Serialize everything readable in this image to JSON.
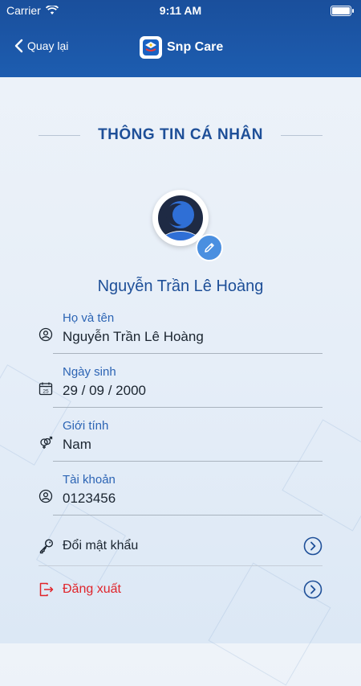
{
  "status": {
    "carrier": "Carrier",
    "time": "9:11 AM"
  },
  "nav": {
    "back_label": "Quay lại",
    "app_name": "Snp Care"
  },
  "section_title": "THÔNG TIN CÁ NHÂN",
  "profile": {
    "display_name": "Nguyễn Trần Lê Hoàng"
  },
  "fields": [
    {
      "label": "Họ và tên",
      "value": "Nguyễn Trần Lê Hoàng",
      "icon": "user-icon"
    },
    {
      "label": "Ngày sinh",
      "value": "29 / 09 / 2000",
      "icon": "calendar-icon",
      "calendar_day": "25"
    },
    {
      "label": "Giới tính",
      "value": "Nam",
      "icon": "gender-icon"
    },
    {
      "label": "Tài khoản",
      "value": "0123456",
      "icon": "user-icon"
    }
  ],
  "actions": {
    "change_password": {
      "label": "Đổi mật khẩu",
      "icon": "key-icon",
      "color": "#1b2530"
    },
    "logout": {
      "label": "Đăng xuất",
      "icon": "logout-icon",
      "color": "#e0242b"
    }
  },
  "colors": {
    "header": "#1d5db0",
    "accent": "#1e4f98",
    "link": "#2c64b4",
    "danger": "#e0242b"
  }
}
